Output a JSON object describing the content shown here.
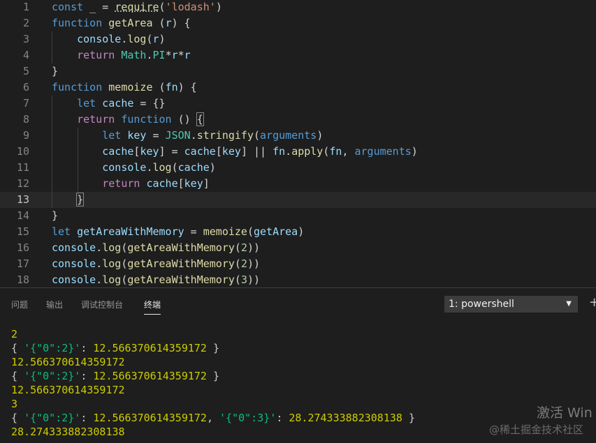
{
  "editor": {
    "line_numbers": [
      "1",
      "2",
      "3",
      "4",
      "5",
      "6",
      "7",
      "8",
      "9",
      "10",
      "11",
      "12",
      "13",
      "14",
      "15",
      "16",
      "17",
      "18"
    ],
    "current_line": "13",
    "lines": [
      [
        {
          "t": "const",
          "c": "kw"
        },
        {
          "t": " _ = ",
          "c": "pl"
        },
        {
          "t": "require",
          "c": "fn squiggle"
        },
        {
          "t": "(",
          "c": "pl"
        },
        {
          "t": "'lodash'",
          "c": "str"
        },
        {
          "t": ")",
          "c": "pl"
        }
      ],
      [
        {
          "t": "function",
          "c": "kw"
        },
        {
          "t": " ",
          "c": "pl"
        },
        {
          "t": "getArea",
          "c": "fn"
        },
        {
          "t": " (",
          "c": "pl"
        },
        {
          "t": "r",
          "c": "var"
        },
        {
          "t": ") {",
          "c": "pl"
        }
      ],
      [
        {
          "t": "    ",
          "c": "pl"
        },
        {
          "t": "console",
          "c": "var"
        },
        {
          "t": ".",
          "c": "pl"
        },
        {
          "t": "log",
          "c": "fn"
        },
        {
          "t": "(",
          "c": "pl"
        },
        {
          "t": "r",
          "c": "var"
        },
        {
          "t": ")",
          "c": "pl"
        }
      ],
      [
        {
          "t": "    ",
          "c": "pl"
        },
        {
          "t": "return",
          "c": "kw2"
        },
        {
          "t": " ",
          "c": "pl"
        },
        {
          "t": "Math",
          "c": "cls"
        },
        {
          "t": ".",
          "c": "pl"
        },
        {
          "t": "PI",
          "c": "cls"
        },
        {
          "t": "*",
          "c": "pl"
        },
        {
          "t": "r",
          "c": "var"
        },
        {
          "t": "*",
          "c": "pl"
        },
        {
          "t": "r",
          "c": "var"
        }
      ],
      [
        {
          "t": "}",
          "c": "pl"
        }
      ],
      [
        {
          "t": "function",
          "c": "kw"
        },
        {
          "t": " ",
          "c": "pl"
        },
        {
          "t": "memoize",
          "c": "fn"
        },
        {
          "t": " (",
          "c": "pl"
        },
        {
          "t": "fn",
          "c": "var"
        },
        {
          "t": ") {",
          "c": "pl"
        }
      ],
      [
        {
          "t": "    ",
          "c": "pl"
        },
        {
          "t": "let",
          "c": "kw"
        },
        {
          "t": " ",
          "c": "pl"
        },
        {
          "t": "cache",
          "c": "var"
        },
        {
          "t": " = {}",
          "c": "pl"
        }
      ],
      [
        {
          "t": "    ",
          "c": "pl"
        },
        {
          "t": "return",
          "c": "kw2"
        },
        {
          "t": " ",
          "c": "pl"
        },
        {
          "t": "function",
          "c": "kw"
        },
        {
          "t": " () ",
          "c": "pl"
        },
        {
          "t": "{",
          "c": "pl cursor-box"
        }
      ],
      [
        {
          "t": "        ",
          "c": "pl"
        },
        {
          "t": "let",
          "c": "kw"
        },
        {
          "t": " ",
          "c": "pl"
        },
        {
          "t": "key",
          "c": "var"
        },
        {
          "t": " = ",
          "c": "pl"
        },
        {
          "t": "JSON",
          "c": "cls"
        },
        {
          "t": ".",
          "c": "pl"
        },
        {
          "t": "stringify",
          "c": "fn"
        },
        {
          "t": "(",
          "c": "pl"
        },
        {
          "t": "arguments",
          "c": "kw"
        },
        {
          "t": ")",
          "c": "pl"
        }
      ],
      [
        {
          "t": "        ",
          "c": "pl"
        },
        {
          "t": "cache",
          "c": "var"
        },
        {
          "t": "[",
          "c": "pl"
        },
        {
          "t": "key",
          "c": "var"
        },
        {
          "t": "] = ",
          "c": "pl"
        },
        {
          "t": "cache",
          "c": "var"
        },
        {
          "t": "[",
          "c": "pl"
        },
        {
          "t": "key",
          "c": "var"
        },
        {
          "t": "] || ",
          "c": "pl"
        },
        {
          "t": "fn",
          "c": "var"
        },
        {
          "t": ".",
          "c": "pl"
        },
        {
          "t": "apply",
          "c": "fn"
        },
        {
          "t": "(",
          "c": "pl"
        },
        {
          "t": "fn",
          "c": "var"
        },
        {
          "t": ", ",
          "c": "pl"
        },
        {
          "t": "arguments",
          "c": "kw"
        },
        {
          "t": ")",
          "c": "pl"
        }
      ],
      [
        {
          "t": "        ",
          "c": "pl"
        },
        {
          "t": "console",
          "c": "var"
        },
        {
          "t": ".",
          "c": "pl"
        },
        {
          "t": "log",
          "c": "fn"
        },
        {
          "t": "(",
          "c": "pl"
        },
        {
          "t": "cache",
          "c": "var"
        },
        {
          "t": ")",
          "c": "pl"
        }
      ],
      [
        {
          "t": "        ",
          "c": "pl"
        },
        {
          "t": "return",
          "c": "kw2"
        },
        {
          "t": " ",
          "c": "pl"
        },
        {
          "t": "cache",
          "c": "var"
        },
        {
          "t": "[",
          "c": "pl"
        },
        {
          "t": "key",
          "c": "var"
        },
        {
          "t": "]",
          "c": "pl"
        }
      ],
      [
        {
          "t": "    ",
          "c": "pl"
        },
        {
          "t": "}",
          "c": "pl cursor-box"
        }
      ],
      [
        {
          "t": "}",
          "c": "pl"
        }
      ],
      [
        {
          "t": "let",
          "c": "kw"
        },
        {
          "t": " ",
          "c": "pl"
        },
        {
          "t": "getAreaWithMemory",
          "c": "var"
        },
        {
          "t": " = ",
          "c": "pl"
        },
        {
          "t": "memoize",
          "c": "fn"
        },
        {
          "t": "(",
          "c": "pl"
        },
        {
          "t": "getArea",
          "c": "var"
        },
        {
          "t": ")",
          "c": "pl"
        }
      ],
      [
        {
          "t": "console",
          "c": "var"
        },
        {
          "t": ".",
          "c": "pl"
        },
        {
          "t": "log",
          "c": "fn"
        },
        {
          "t": "(",
          "c": "pl"
        },
        {
          "t": "getAreaWithMemory",
          "c": "fn"
        },
        {
          "t": "(",
          "c": "pl"
        },
        {
          "t": "2",
          "c": "num"
        },
        {
          "t": "))",
          "c": "pl"
        }
      ],
      [
        {
          "t": "console",
          "c": "var"
        },
        {
          "t": ".",
          "c": "pl"
        },
        {
          "t": "log",
          "c": "fn"
        },
        {
          "t": "(",
          "c": "pl"
        },
        {
          "t": "getAreaWithMemory",
          "c": "fn"
        },
        {
          "t": "(",
          "c": "pl"
        },
        {
          "t": "2",
          "c": "num"
        },
        {
          "t": "))",
          "c": "pl"
        }
      ],
      [
        {
          "t": "console",
          "c": "var"
        },
        {
          "t": ".",
          "c": "pl"
        },
        {
          "t": "log",
          "c": "fn"
        },
        {
          "t": "(",
          "c": "pl"
        },
        {
          "t": "getAreaWithMemory",
          "c": "fn"
        },
        {
          "t": "(",
          "c": "pl"
        },
        {
          "t": "3",
          "c": "num"
        },
        {
          "t": "))",
          "c": "pl"
        }
      ]
    ]
  },
  "panel": {
    "tabs": [
      {
        "label": "问题",
        "active": false
      },
      {
        "label": "输出",
        "active": false
      },
      {
        "label": "调试控制台",
        "active": false
      },
      {
        "label": "终端",
        "active": true
      }
    ],
    "terminal_select": "1: powershell",
    "add_icon": "plus-icon"
  },
  "terminal": {
    "lines": [
      [
        {
          "t": "2",
          "c": "t-num"
        }
      ],
      [
        {
          "t": "{ ",
          "c": "t-pl"
        },
        {
          "t": "'{\"0\":2}'",
          "c": "t-str"
        },
        {
          "t": ": ",
          "c": "t-pl"
        },
        {
          "t": "12.566370614359172",
          "c": "t-num"
        },
        {
          "t": " }",
          "c": "t-pl"
        }
      ],
      [
        {
          "t": "12.566370614359172",
          "c": "t-num"
        }
      ],
      [
        {
          "t": "{ ",
          "c": "t-pl"
        },
        {
          "t": "'{\"0\":2}'",
          "c": "t-str"
        },
        {
          "t": ": ",
          "c": "t-pl"
        },
        {
          "t": "12.566370614359172",
          "c": "t-num"
        },
        {
          "t": " }",
          "c": "t-pl"
        }
      ],
      [
        {
          "t": "12.566370614359172",
          "c": "t-num"
        }
      ],
      [
        {
          "t": "3",
          "c": "t-num"
        }
      ],
      [
        {
          "t": "{ ",
          "c": "t-pl"
        },
        {
          "t": "'{\"0\":2}'",
          "c": "t-str"
        },
        {
          "t": ": ",
          "c": "t-pl"
        },
        {
          "t": "12.566370614359172",
          "c": "t-num"
        },
        {
          "t": ", ",
          "c": "t-pl"
        },
        {
          "t": "'{\"0\":3}'",
          "c": "t-str"
        },
        {
          "t": ": ",
          "c": "t-pl"
        },
        {
          "t": "28.274333882308138",
          "c": "t-num"
        },
        {
          "t": " }",
          "c": "t-pl"
        }
      ],
      [
        {
          "t": "28.274333882308138",
          "c": "t-num"
        }
      ]
    ]
  },
  "watermarks": {
    "activate": "激活 Win",
    "juejin": "@稀土掘金技术社区"
  }
}
